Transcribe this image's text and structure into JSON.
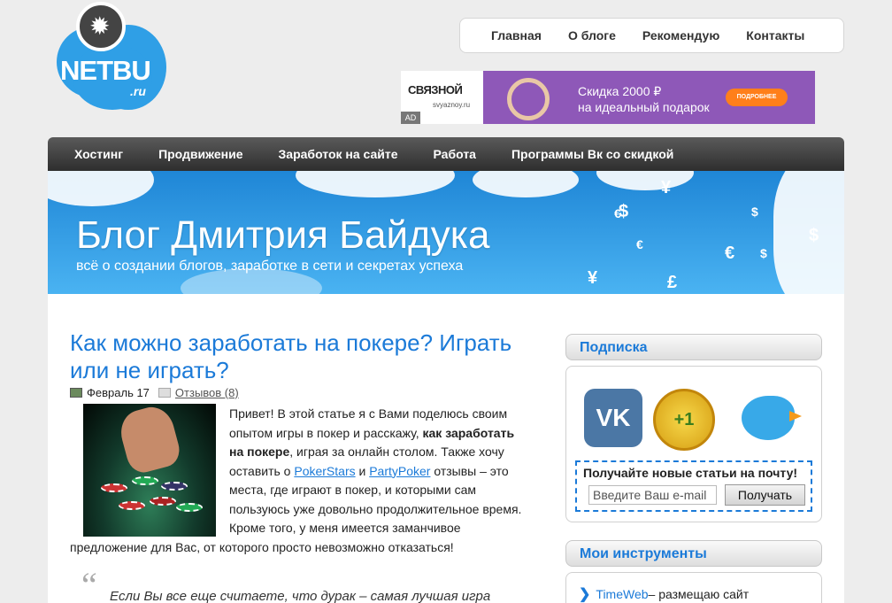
{
  "logo": {
    "text": "NETBU",
    "suffix": ".ru"
  },
  "top_menu": [
    "Главная",
    "О блоге",
    "Рекомендую",
    "Контакты"
  ],
  "ad": {
    "brand": "СВЯЗНОЙ",
    "url": "svyaznoy.ru",
    "mark": "AD",
    "text": "Скидка 2000 ₽\nна идеальный подарок",
    "button": "ПОДРОБНЕЕ"
  },
  "main_nav": [
    "Хостинг",
    "Продвижение",
    "Заработок на сайте",
    "Работа",
    "Программы Вк со скидкой"
  ],
  "header": {
    "title": "Блог Дмитрия Байдука",
    "subtitle": "всё о создании блогов, заработке в сети и секретах успеха",
    "symbols": [
      "¥",
      "$",
      "€",
      "€",
      "$",
      "£",
      "¥",
      "$",
      "€",
      "$"
    ]
  },
  "post": {
    "title": "Как можно заработать на покере? Играть или не играть?",
    "date": "Февраль 17",
    "comments": "Отзывов (8)",
    "body": {
      "p1": "Привет! В этой статье я с Вами поделюсь своим опытом игры в покер и расскажу, ",
      "bold1": "как заработать на покере",
      "p2": ", играя за онлайн столом. Также хочу оставить о ",
      "link1": "PokerStars",
      "and": " и ",
      "link2": "PartyPoker",
      "p3": " отзывы – это места, где играют в покер, и которыми сам пользуюсь уже довольно продолжительное время. Кроме того, у меня имеется заманчивое предложение для Вас, от которого просто невозможно отказаться!"
    },
    "quote_mark": "“",
    "quote": "Если Вы все еще считаете, что дурак – самая лучшая игра"
  },
  "sidebar": {
    "subscribe": {
      "title": "Подписка",
      "icons": {
        "vk": "VK",
        "gplus": "+1"
      },
      "form_label": "Получайте новые статьи на почту!",
      "placeholder": "Введите Ваш e-mail",
      "button": "Получать"
    },
    "tools": {
      "title": "Мои инструменты",
      "items": [
        {
          "link": "TimeWeb",
          "text": " – размещаю сайт"
        }
      ]
    }
  },
  "colors": {
    "accent": "#1b7ad8",
    "nav_bg": "#3a3a3a",
    "header_bg": "#2f9fe6"
  }
}
